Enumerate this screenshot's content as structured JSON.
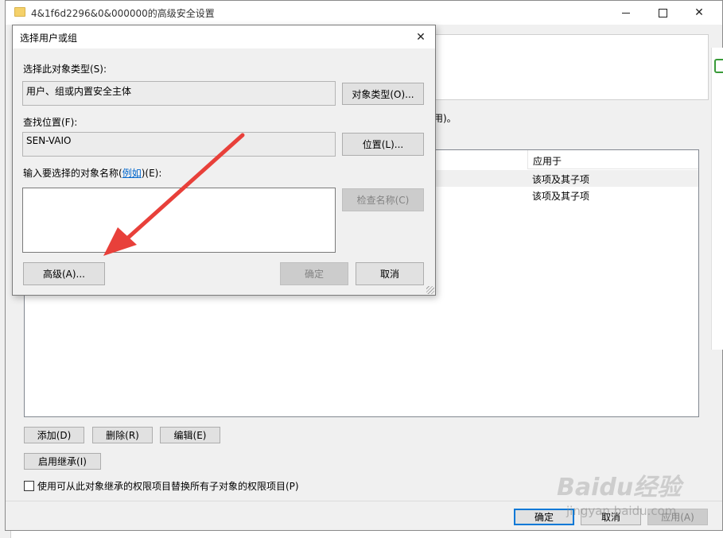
{
  "main_window": {
    "title": "4&1f6d2296&0&000000的高级安全设置",
    "partial_desc": "用)。",
    "applies_header": "应用于",
    "entries": [
      {
        "applies": "该项及其子项"
      },
      {
        "applies": "该项及其子项"
      }
    ],
    "buttons": {
      "add": "添加(D)",
      "remove": "删除(R)",
      "edit": "编辑(E)",
      "enable_inheritance": "启用继承(I)",
      "ok": "确定",
      "cancel": "取消",
      "apply": "应用(A)"
    },
    "replace_checkbox_label": "使用可从此对象继承的权限项目替换所有子对象的权限项目(P)",
    "replace_checked": false
  },
  "dialog": {
    "title": "选择用户或组",
    "object_type_label": "选择此对象类型(S):",
    "object_type_value": "用户、组或内置安全主体",
    "object_type_button": "对象类型(O)...",
    "location_label": "查找位置(F):",
    "location_value": "SEN-VAIO",
    "location_button": "位置(L)...",
    "enter_names_label_prefix": "输入要选择的对象名称(",
    "enter_names_link": "例如",
    "enter_names_label_suffix": ")(E):",
    "names_value": "",
    "check_names_button": "检查名称(C)",
    "advanced_button": "高级(A)...",
    "ok_button": "确定",
    "cancel_button": "取消"
  },
  "watermark": {
    "brand": "Baidu经验",
    "url": "jingyan.baidu.com"
  },
  "colors": {
    "arrow": "#e8403a",
    "link": "#0066cc",
    "selected_row": "#f0f0f0"
  }
}
